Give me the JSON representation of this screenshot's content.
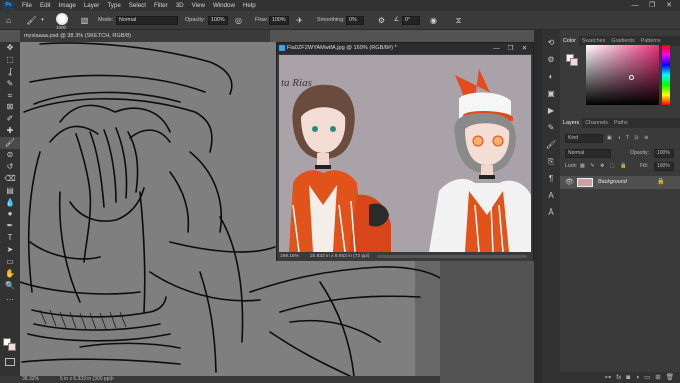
{
  "app": {
    "logo": "Ps"
  },
  "menu": [
    "File",
    "Edit",
    "Image",
    "Layer",
    "Type",
    "Select",
    "Filter",
    "3D",
    "View",
    "Window",
    "Help"
  ],
  "window_controls": {
    "minimize": "—",
    "restore": "❐",
    "close": "✕"
  },
  "options": {
    "brush_size": "1000",
    "mode_label": "Mode:",
    "mode_value": "Normal",
    "opacity_label": "Opacity:",
    "opacity_value": "100%",
    "flow_label": "Flow:",
    "flow_value": "100%",
    "smoothing_label": "Smoothing:",
    "smoothing_value": "0%",
    "angle_value": "0°"
  },
  "document": {
    "tab_title": "myslaaaa.psd @ 38.3% (SKETCH, RGB/8)",
    "zoom": "38.32%",
    "doc_info": "5 in x 6.333 in (300 ppi)"
  },
  "floating_doc": {
    "title": "Fla0ZF2WYAMwtfA.jpg @ 169% (RGB/8#) *",
    "zoom": "169.16%",
    "size": "20.833 in x 9.653 in (72 ppi)",
    "image_text": "ta Rias"
  },
  "panels": {
    "color_tabs": [
      "Color",
      "Swatches",
      "Gradients",
      "Patterns"
    ],
    "layers_tabs": [
      "Layers",
      "Channels",
      "Paths"
    ],
    "filter_placeholder": "Kind",
    "blend_mode": "Normal",
    "opacity_label": "Opacity:",
    "opacity_value": "100%",
    "lock_label": "Lock:",
    "fill_label": "Fill:",
    "fill_value": "100%",
    "layer_name": "Background",
    "fg_color": "#f4f4f4",
    "bg_color": "#f3d9d2"
  },
  "tools": [
    "move-icon",
    "marquee-icon",
    "lasso-icon",
    "quick-select-icon",
    "crop-icon",
    "frame-icon",
    "eyedropper-icon",
    "healing-icon",
    "brush-icon",
    "stamp-icon",
    "history-brush-icon",
    "eraser-icon",
    "gradient-icon",
    "blur-icon",
    "dodge-icon",
    "pen-icon",
    "type-icon",
    "path-select-icon",
    "shape-icon",
    "hand-icon",
    "zoom-icon",
    "more-icon"
  ],
  "tool_glyphs": [
    "✥",
    "⬚",
    "ʆ",
    "✎",
    "⌗",
    "⊠",
    "✐",
    "✚",
    "🖌",
    "⊜",
    "↺",
    "⌫",
    "▤",
    "💧",
    "●",
    "✒",
    "T",
    "➤",
    "▭",
    "✋",
    "🔍",
    "…"
  ]
}
